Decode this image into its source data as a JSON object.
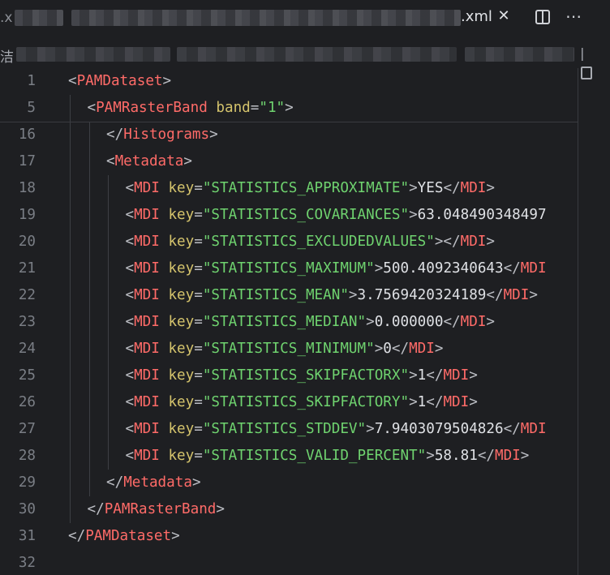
{
  "tab": {
    "left_edge": ".x",
    "name": ".xml",
    "close": "✕",
    "split_icon": "split-editor-icon",
    "more_icon": "⋯"
  },
  "breadcrumb": {
    "left": "洁",
    "right": "|"
  },
  "colors": {
    "background": "#1e1f22",
    "tag": "#ff6b68",
    "attribute": "#d4c36c",
    "string": "#6fd36f",
    "line_number": "#7a7e85"
  },
  "lines": [
    {
      "n": "1",
      "indent": 0,
      "parts": [
        [
          "br",
          "<"
        ],
        [
          "tag",
          "PAMDataset"
        ],
        [
          "br",
          ">"
        ]
      ]
    },
    {
      "n": "5",
      "indent": 1,
      "parts": [
        [
          "br",
          "<"
        ],
        [
          "tag",
          "PAMRasterBand"
        ],
        [
          "txt",
          " "
        ],
        [
          "attr",
          "band"
        ],
        [
          "br",
          "="
        ],
        [
          "val",
          "\"1\""
        ],
        [
          "br",
          ">"
        ]
      ]
    },
    {
      "n": "16",
      "indent": 2,
      "parts": [
        [
          "br",
          "</"
        ],
        [
          "tag",
          "Histograms"
        ],
        [
          "br",
          ">"
        ]
      ]
    },
    {
      "n": "17",
      "indent": 2,
      "parts": [
        [
          "br",
          "<"
        ],
        [
          "tag",
          "Metadata"
        ],
        [
          "br",
          ">"
        ]
      ]
    },
    {
      "n": "18",
      "indent": 3,
      "parts": [
        [
          "br",
          "<"
        ],
        [
          "tag",
          "MDI"
        ],
        [
          "txt",
          " "
        ],
        [
          "attr",
          "key"
        ],
        [
          "br",
          "="
        ],
        [
          "val",
          "\"STATISTICS_APPROXIMATE\""
        ],
        [
          "br",
          ">"
        ],
        [
          "txt",
          "YES"
        ],
        [
          "br",
          "</"
        ],
        [
          "tag",
          "MDI"
        ],
        [
          "br",
          ">"
        ]
      ]
    },
    {
      "n": "19",
      "indent": 3,
      "parts": [
        [
          "br",
          "<"
        ],
        [
          "tag",
          "MDI"
        ],
        [
          "txt",
          " "
        ],
        [
          "attr",
          "key"
        ],
        [
          "br",
          "="
        ],
        [
          "val",
          "\"STATISTICS_COVARIANCES\""
        ],
        [
          "br",
          ">"
        ],
        [
          "txt",
          "63.048490348497"
        ]
      ]
    },
    {
      "n": "20",
      "indent": 3,
      "parts": [
        [
          "br",
          "<"
        ],
        [
          "tag",
          "MDI"
        ],
        [
          "txt",
          " "
        ],
        [
          "attr",
          "key"
        ],
        [
          "br",
          "="
        ],
        [
          "val",
          "\"STATISTICS_EXCLUDEDVALUES\""
        ],
        [
          "br",
          "></"
        ],
        [
          "tag",
          "MDI"
        ],
        [
          "br",
          ">"
        ]
      ]
    },
    {
      "n": "21",
      "indent": 3,
      "parts": [
        [
          "br",
          "<"
        ],
        [
          "tag",
          "MDI"
        ],
        [
          "txt",
          " "
        ],
        [
          "attr",
          "key"
        ],
        [
          "br",
          "="
        ],
        [
          "val",
          "\"STATISTICS_MAXIMUM\""
        ],
        [
          "br",
          ">"
        ],
        [
          "txt",
          "500.4092340643"
        ],
        [
          "br",
          "</"
        ],
        [
          "tag",
          "MDI"
        ]
      ]
    },
    {
      "n": "22",
      "indent": 3,
      "parts": [
        [
          "br",
          "<"
        ],
        [
          "tag",
          "MDI"
        ],
        [
          "txt",
          " "
        ],
        [
          "attr",
          "key"
        ],
        [
          "br",
          "="
        ],
        [
          "val",
          "\"STATISTICS_MEAN\""
        ],
        [
          "br",
          ">"
        ],
        [
          "txt",
          "3.7569420324189"
        ],
        [
          "br",
          "</"
        ],
        [
          "tag",
          "MDI"
        ],
        [
          "br",
          ">"
        ]
      ]
    },
    {
      "n": "23",
      "indent": 3,
      "parts": [
        [
          "br",
          "<"
        ],
        [
          "tag",
          "MDI"
        ],
        [
          "txt",
          " "
        ],
        [
          "attr",
          "key"
        ],
        [
          "br",
          "="
        ],
        [
          "val",
          "\"STATISTICS_MEDIAN\""
        ],
        [
          "br",
          ">"
        ],
        [
          "txt",
          "0.000000"
        ],
        [
          "br",
          "</"
        ],
        [
          "tag",
          "MDI"
        ],
        [
          "br",
          ">"
        ]
      ]
    },
    {
      "n": "24",
      "indent": 3,
      "parts": [
        [
          "br",
          "<"
        ],
        [
          "tag",
          "MDI"
        ],
        [
          "txt",
          " "
        ],
        [
          "attr",
          "key"
        ],
        [
          "br",
          "="
        ],
        [
          "val",
          "\"STATISTICS_MINIMUM\""
        ],
        [
          "br",
          ">"
        ],
        [
          "txt",
          "0"
        ],
        [
          "br",
          "</"
        ],
        [
          "tag",
          "MDI"
        ],
        [
          "br",
          ">"
        ]
      ]
    },
    {
      "n": "25",
      "indent": 3,
      "parts": [
        [
          "br",
          "<"
        ],
        [
          "tag",
          "MDI"
        ],
        [
          "txt",
          " "
        ],
        [
          "attr",
          "key"
        ],
        [
          "br",
          "="
        ],
        [
          "val",
          "\"STATISTICS_SKIPFACTORX\""
        ],
        [
          "br",
          ">"
        ],
        [
          "txt",
          "1"
        ],
        [
          "br",
          "</"
        ],
        [
          "tag",
          "MDI"
        ],
        [
          "br",
          ">"
        ]
      ]
    },
    {
      "n": "26",
      "indent": 3,
      "parts": [
        [
          "br",
          "<"
        ],
        [
          "tag",
          "MDI"
        ],
        [
          "txt",
          " "
        ],
        [
          "attr",
          "key"
        ],
        [
          "br",
          "="
        ],
        [
          "val",
          "\"STATISTICS_SKIPFACTORY\""
        ],
        [
          "br",
          ">"
        ],
        [
          "txt",
          "1"
        ],
        [
          "br",
          "</"
        ],
        [
          "tag",
          "MDI"
        ],
        [
          "br",
          ">"
        ]
      ]
    },
    {
      "n": "27",
      "indent": 3,
      "parts": [
        [
          "br",
          "<"
        ],
        [
          "tag",
          "MDI"
        ],
        [
          "txt",
          " "
        ],
        [
          "attr",
          "key"
        ],
        [
          "br",
          "="
        ],
        [
          "val",
          "\"STATISTICS_STDDEV\""
        ],
        [
          "br",
          ">"
        ],
        [
          "txt",
          "7.9403079504826"
        ],
        [
          "br",
          "</"
        ],
        [
          "tag",
          "MDI"
        ]
      ]
    },
    {
      "n": "28",
      "indent": 3,
      "parts": [
        [
          "br",
          "<"
        ],
        [
          "tag",
          "MDI"
        ],
        [
          "txt",
          " "
        ],
        [
          "attr",
          "key"
        ],
        [
          "br",
          "="
        ],
        [
          "val",
          "\"STATISTICS_VALID_PERCENT\""
        ],
        [
          "br",
          ">"
        ],
        [
          "txt",
          "58.81"
        ],
        [
          "br",
          "</"
        ],
        [
          "tag",
          "MDI"
        ],
        [
          "br",
          ">"
        ]
      ]
    },
    {
      "n": "29",
      "indent": 2,
      "parts": [
        [
          "br",
          "</"
        ],
        [
          "tag",
          "Metadata"
        ],
        [
          "br",
          ">"
        ]
      ]
    },
    {
      "n": "30",
      "indent": 1,
      "parts": [
        [
          "br",
          "</"
        ],
        [
          "tag",
          "PAMRasterBand"
        ],
        [
          "br",
          ">"
        ]
      ]
    },
    {
      "n": "31",
      "indent": 0,
      "parts": [
        [
          "br",
          "</"
        ],
        [
          "tag",
          "PAMDataset"
        ],
        [
          "br",
          ">"
        ]
      ]
    },
    {
      "n": "32",
      "indent": 0,
      "parts": []
    }
  ]
}
